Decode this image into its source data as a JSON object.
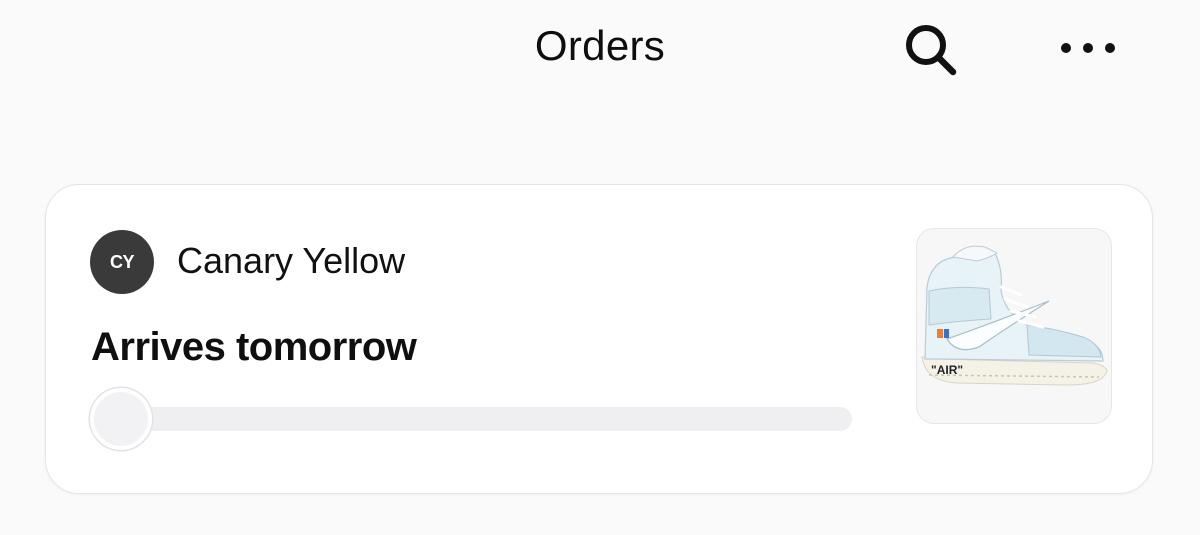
{
  "header": {
    "title": "Orders",
    "search_icon": "search-icon",
    "more_icon": "more-horizontal-icon"
  },
  "order": {
    "seller_initials": "CY",
    "seller_name": "Canary Yellow",
    "status": "Arrives tomorrow",
    "progress": 0,
    "product_image": "sneaker-image",
    "product_print": "\"AIR\""
  },
  "colors": {
    "background": "#fafafa",
    "card": "#ffffff",
    "avatar": "#3a3a3a",
    "progress_track": "#efeff2"
  }
}
